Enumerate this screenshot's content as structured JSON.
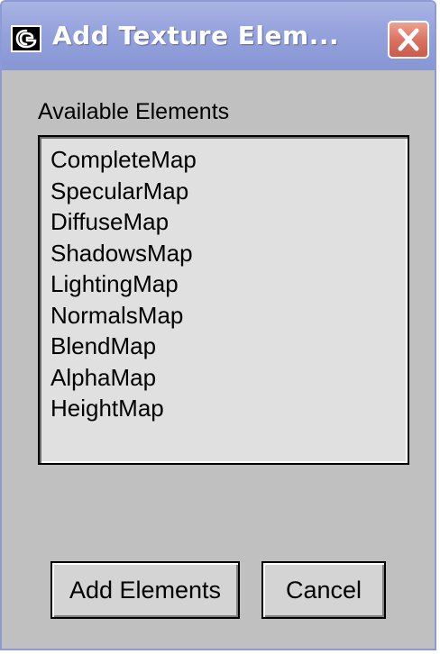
{
  "window": {
    "title": "Add Texture Elem...",
    "icon": "app-logo-icon",
    "close_icon": "close-icon"
  },
  "elements_list": {
    "label": "Available Elements",
    "items": [
      "CompleteMap",
      "SpecularMap",
      "DiffuseMap",
      "ShadowsMap",
      "LightingMap",
      "NormalsMap",
      "BlendMap",
      "AlphaMap",
      "HeightMap"
    ]
  },
  "buttons": {
    "add_label": "Add Elements",
    "cancel_label": "Cancel"
  },
  "colors": {
    "titlebar": "#95a2dc",
    "close_button": "#d87060",
    "dialog_background": "#c0c0c0",
    "list_background": "#e0e0e0"
  }
}
